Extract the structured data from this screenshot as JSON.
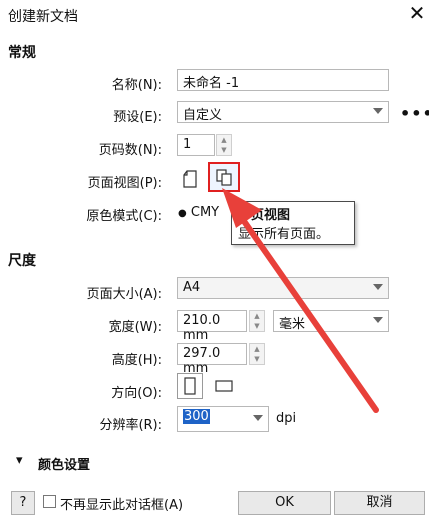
{
  "window": {
    "title": "创建新文档",
    "close_glyph": "✕"
  },
  "general": {
    "section_label": "常规",
    "name_label": "名称(N):",
    "name_value": "未命名 -1",
    "preset_label": "预设(E):",
    "preset_value": "自定义",
    "pages_label": "页码数(N):",
    "pages_value": "1",
    "page_view_label": "页面视图(P):",
    "color_mode_label": "原色模式(C):",
    "color_mode_value": "CMY"
  },
  "tooltip": {
    "title": "多页视图",
    "description": "显示所有页面。"
  },
  "dimensions": {
    "section_label": "尺度",
    "page_size_label": "页面大小(A):",
    "page_size_value": "A4",
    "width_label": "宽度(W):",
    "width_value": "210.0 mm",
    "unit_value": "毫米",
    "height_label": "高度(H):",
    "height_value": "297.0 mm",
    "orientation_label": "方向(O):",
    "resolution_label": "分辨率(R):",
    "resolution_value": "300",
    "resolution_unit": "dpi"
  },
  "color_settings": {
    "label": "颜色设置",
    "chevron_glyph": "▾"
  },
  "footer": {
    "help_label": "?",
    "dont_show_label": "不再显示此对话框(A)",
    "ok_label": "OK",
    "cancel_label": "取消"
  },
  "colors": {
    "highlight": "#e02020",
    "arrow": "#e8403a"
  }
}
